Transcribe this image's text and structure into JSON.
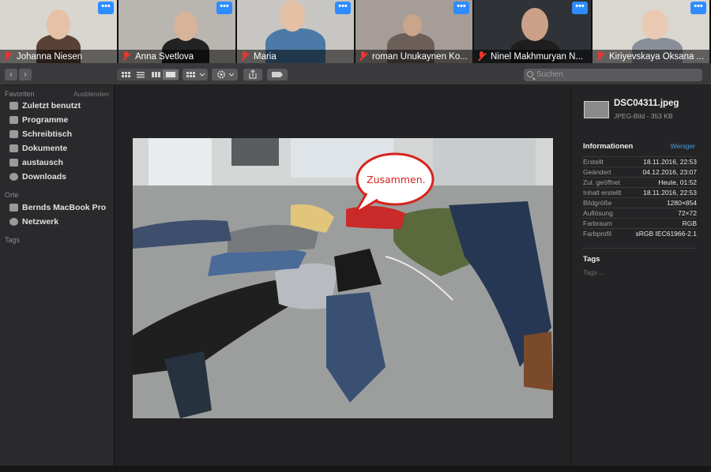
{
  "participants": [
    {
      "name": "Johanna Niesen",
      "more": "•••",
      "bg": "#d9d5cf",
      "skin": "#e5c1a7",
      "shirt": "#5a4135"
    },
    {
      "name": "Anna Svetlova",
      "more": "•••",
      "bg": "#b9b5b0",
      "skin": "#d7b39b",
      "shirt": "#222"
    },
    {
      "name": "Maria",
      "more": "•••",
      "bg": "#c8c6c2",
      "skin": "#e4c0a5",
      "shirt": "#4b7aa8"
    },
    {
      "name": "roman Unukaynen Ko...",
      "more": "•••",
      "bg": "#a69d98",
      "skin": "#c9a58c",
      "shirt": "#6c5f59"
    },
    {
      "name": "Ninel Makhmuryan N...",
      "more": "•••",
      "bg": "#2f3236",
      "skin": "#caa188",
      "shirt": "#1e1e1e"
    },
    {
      "name": "Kiriyevskaya Oksana ...",
      "more": "•••",
      "bg": "#dad6d0",
      "skin": "#eac9b3",
      "shirt": "#8a8e98"
    }
  ],
  "toolbar": {
    "search_placeholder": "Suchen",
    "back": "‹",
    "forward": "›",
    "tag_icon": "tag-icon",
    "share_icon": "share-icon",
    "gear_icon": "gear-icon"
  },
  "sidebar": {
    "favorites_title": "Favoriten",
    "hide_label": "Ausblenden",
    "favorites": [
      {
        "label": "Zuletzt benutzt",
        "icon": "recents-icon"
      },
      {
        "label": "Programme",
        "icon": "applications-icon"
      },
      {
        "label": "Schreibtisch",
        "icon": "desktop-icon"
      },
      {
        "label": "Dokumente",
        "icon": "documents-icon"
      },
      {
        "label": "austausch",
        "icon": "folder-icon"
      },
      {
        "label": "Downloads",
        "icon": "downloads-icon"
      }
    ],
    "places_title": "Orte",
    "places": [
      {
        "label": "Bernds MacBook Pro",
        "icon": "laptop-icon"
      },
      {
        "label": "Netzwerk",
        "icon": "network-icon"
      }
    ],
    "tags_title": "Tags"
  },
  "preview": {
    "speech_bubble": "Zusammen."
  },
  "inspector": {
    "file_name": "DSC04311.jpeg",
    "file_meta": "JPEG-Bild - 353 KB",
    "info_title": "Informationen",
    "less_label": "Weniger",
    "rows": [
      {
        "key": "Erstellt",
        "value": "18.11.2016, 22:53"
      },
      {
        "key": "Geändert",
        "value": "04.12.2016, 23:07"
      },
      {
        "key": "Zul. geöffnet",
        "value": "Heute, 01:52"
      },
      {
        "key": "Inhalt erstellt",
        "value": "18.11.2016, 22:53"
      },
      {
        "key": "Bildgröße",
        "value": "1280×854"
      },
      {
        "key": "Auflösung",
        "value": "72×72"
      },
      {
        "key": "Farbraum",
        "value": "RGB"
      },
      {
        "key": "Farbprofil",
        "value": "sRGB IEC61966-2.1"
      }
    ],
    "tags_title": "Tags",
    "tags_placeholder": "Tags ..."
  },
  "colors": {
    "accent_blue": "#2d8cff",
    "mute_red": "#e8372e",
    "link_blue": "#4a9be0"
  }
}
